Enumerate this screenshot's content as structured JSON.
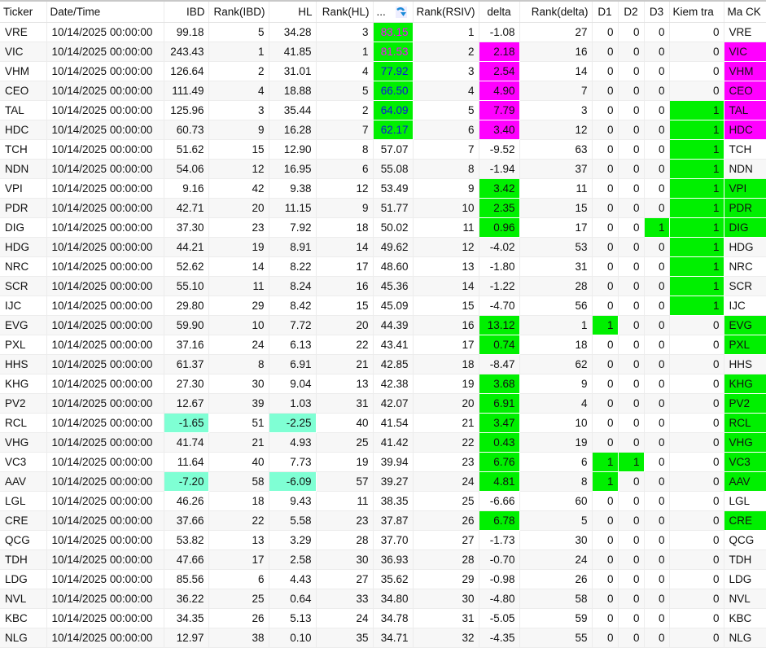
{
  "columns": [
    "Ticker",
    "Date/Time",
    "IBD",
    "Rank(IBD)",
    "HL",
    "Rank(HL)",
    "...",
    "Rank(RSIV)",
    "delta",
    "Rank(delta)",
    "D1",
    "D2",
    "D3",
    "Kiem tra",
    "Ma CK"
  ],
  "sort_icon": "sort-descending-icon",
  "colors": {
    "green": "#00f000",
    "magenta": "#ff00ff",
    "aqua": "#7fffd4",
    "blue_text": "#1010e0",
    "magenta_text": "#ff00ff"
  },
  "rows": [
    {
      "ticker": "VRE",
      "date": "10/14/2025 00:00:00",
      "ibd": "99.18",
      "rank_ibd": "5",
      "hl": "34.28",
      "rank_hl": "3",
      "rsiv": "83.15",
      "rsiv_style": "magenta",
      "rank_rsiv": "1",
      "delta": "-1.08",
      "delta_color": "",
      "rank_delta": "27",
      "d1": "0",
      "d2": "0",
      "d3": "0",
      "kiem_tra": "0",
      "ma_ck": "VRE"
    },
    {
      "ticker": "VIC",
      "date": "10/14/2025 00:00:00",
      "ibd": "243.43",
      "rank_ibd": "1",
      "hl": "41.85",
      "rank_hl": "1",
      "rsiv": "81.53",
      "rsiv_style": "magenta",
      "rank_rsiv": "2",
      "delta": "2.18",
      "delta_color": "magenta",
      "rank_delta": "16",
      "d1": "0",
      "d2": "0",
      "d3": "0",
      "kiem_tra": "0",
      "ma_ck": "VIC"
    },
    {
      "ticker": "VHM",
      "date": "10/14/2025 00:00:00",
      "ibd": "126.64",
      "rank_ibd": "2",
      "hl": "31.01",
      "rank_hl": "4",
      "rsiv": "77.92",
      "rsiv_style": "blue",
      "rank_rsiv": "3",
      "delta": "2.54",
      "delta_color": "magenta",
      "rank_delta": "14",
      "d1": "0",
      "d2": "0",
      "d3": "0",
      "kiem_tra": "0",
      "ma_ck": "VHM"
    },
    {
      "ticker": "CEO",
      "date": "10/14/2025 00:00:00",
      "ibd": "111.49",
      "rank_ibd": "4",
      "hl": "18.88",
      "rank_hl": "5",
      "rsiv": "66.50",
      "rsiv_style": "blue",
      "rank_rsiv": "4",
      "delta": "4.90",
      "delta_color": "magenta",
      "rank_delta": "7",
      "d1": "0",
      "d2": "0",
      "d3": "0",
      "kiem_tra": "0",
      "ma_ck": "CEO"
    },
    {
      "ticker": "TAL",
      "date": "10/14/2025 00:00:00",
      "ibd": "125.96",
      "rank_ibd": "3",
      "hl": "35.44",
      "rank_hl": "2",
      "rsiv": "64.09",
      "rsiv_style": "blue",
      "rank_rsiv": "5",
      "delta": "7.79",
      "delta_color": "magenta",
      "rank_delta": "3",
      "d1": "0",
      "d2": "0",
      "d3": "0",
      "kiem_tra": "1",
      "ma_ck": "TAL"
    },
    {
      "ticker": "HDC",
      "date": "10/14/2025 00:00:00",
      "ibd": "60.73",
      "rank_ibd": "9",
      "hl": "16.28",
      "rank_hl": "7",
      "rsiv": "62.17",
      "rsiv_style": "blue",
      "rank_rsiv": "6",
      "delta": "3.40",
      "delta_color": "magenta",
      "rank_delta": "12",
      "d1": "0",
      "d2": "0",
      "d3": "0",
      "kiem_tra": "1",
      "ma_ck": "HDC"
    },
    {
      "ticker": "TCH",
      "date": "10/14/2025 00:00:00",
      "ibd": "51.62",
      "rank_ibd": "15",
      "hl": "12.90",
      "rank_hl": "8",
      "rsiv": "57.07",
      "rsiv_style": "",
      "rank_rsiv": "7",
      "delta": "-9.52",
      "delta_color": "",
      "rank_delta": "63",
      "d1": "0",
      "d2": "0",
      "d3": "0",
      "kiem_tra": "1",
      "ma_ck": "TCH"
    },
    {
      "ticker": "NDN",
      "date": "10/14/2025 00:00:00",
      "ibd": "54.06",
      "rank_ibd": "12",
      "hl": "16.95",
      "rank_hl": "6",
      "rsiv": "55.08",
      "rsiv_style": "",
      "rank_rsiv": "8",
      "delta": "-1.94",
      "delta_color": "",
      "rank_delta": "37",
      "d1": "0",
      "d2": "0",
      "d3": "0",
      "kiem_tra": "1",
      "ma_ck": "NDN"
    },
    {
      "ticker": "VPI",
      "date": "10/14/2025 00:00:00",
      "ibd": "9.16",
      "rank_ibd": "42",
      "hl": "9.38",
      "rank_hl": "12",
      "rsiv": "53.49",
      "rsiv_style": "",
      "rank_rsiv": "9",
      "delta": "3.42",
      "delta_color": "green",
      "rank_delta": "11",
      "d1": "0",
      "d2": "0",
      "d3": "0",
      "kiem_tra": "1",
      "ma_ck": "VPI"
    },
    {
      "ticker": "PDR",
      "date": "10/14/2025 00:00:00",
      "ibd": "42.71",
      "rank_ibd": "20",
      "hl": "11.15",
      "rank_hl": "9",
      "rsiv": "51.77",
      "rsiv_style": "",
      "rank_rsiv": "10",
      "delta": "2.35",
      "delta_color": "green",
      "rank_delta": "15",
      "d1": "0",
      "d2": "0",
      "d3": "0",
      "kiem_tra": "1",
      "ma_ck": "PDR"
    },
    {
      "ticker": "DIG",
      "date": "10/14/2025 00:00:00",
      "ibd": "37.30",
      "rank_ibd": "23",
      "hl": "7.92",
      "rank_hl": "18",
      "rsiv": "50.02",
      "rsiv_style": "",
      "rank_rsiv": "11",
      "delta": "0.96",
      "delta_color": "green",
      "rank_delta": "17",
      "d1": "0",
      "d2": "0",
      "d3": "1",
      "kiem_tra": "1",
      "ma_ck": "DIG"
    },
    {
      "ticker": "HDG",
      "date": "10/14/2025 00:00:00",
      "ibd": "44.21",
      "rank_ibd": "19",
      "hl": "8.91",
      "rank_hl": "14",
      "rsiv": "49.62",
      "rsiv_style": "",
      "rank_rsiv": "12",
      "delta": "-4.02",
      "delta_color": "",
      "rank_delta": "53",
      "d1": "0",
      "d2": "0",
      "d3": "0",
      "kiem_tra": "1",
      "ma_ck": "HDG"
    },
    {
      "ticker": "NRC",
      "date": "10/14/2025 00:00:00",
      "ibd": "52.62",
      "rank_ibd": "14",
      "hl": "8.22",
      "rank_hl": "17",
      "rsiv": "48.60",
      "rsiv_style": "",
      "rank_rsiv": "13",
      "delta": "-1.80",
      "delta_color": "",
      "rank_delta": "31",
      "d1": "0",
      "d2": "0",
      "d3": "0",
      "kiem_tra": "1",
      "ma_ck": "NRC"
    },
    {
      "ticker": "SCR",
      "date": "10/14/2025 00:00:00",
      "ibd": "55.10",
      "rank_ibd": "11",
      "hl": "8.24",
      "rank_hl": "16",
      "rsiv": "45.36",
      "rsiv_style": "",
      "rank_rsiv": "14",
      "delta": "-1.22",
      "delta_color": "",
      "rank_delta": "28",
      "d1": "0",
      "d2": "0",
      "d3": "0",
      "kiem_tra": "1",
      "ma_ck": "SCR"
    },
    {
      "ticker": "IJC",
      "date": "10/14/2025 00:00:00",
      "ibd": "29.80",
      "rank_ibd": "29",
      "hl": "8.42",
      "rank_hl": "15",
      "rsiv": "45.09",
      "rsiv_style": "",
      "rank_rsiv": "15",
      "delta": "-4.70",
      "delta_color": "",
      "rank_delta": "56",
      "d1": "0",
      "d2": "0",
      "d3": "0",
      "kiem_tra": "1",
      "ma_ck": "IJC"
    },
    {
      "ticker": "EVG",
      "date": "10/14/2025 00:00:00",
      "ibd": "59.90",
      "rank_ibd": "10",
      "hl": "7.72",
      "rank_hl": "20",
      "rsiv": "44.39",
      "rsiv_style": "",
      "rank_rsiv": "16",
      "delta": "13.12",
      "delta_color": "green",
      "rank_delta": "1",
      "d1": "1",
      "d2": "0",
      "d3": "0",
      "kiem_tra": "0",
      "ma_ck": "EVG"
    },
    {
      "ticker": "PXL",
      "date": "10/14/2025 00:00:00",
      "ibd": "37.16",
      "rank_ibd": "24",
      "hl": "6.13",
      "rank_hl": "22",
      "rsiv": "43.41",
      "rsiv_style": "",
      "rank_rsiv": "17",
      "delta": "0.74",
      "delta_color": "green",
      "rank_delta": "18",
      "d1": "0",
      "d2": "0",
      "d3": "0",
      "kiem_tra": "0",
      "ma_ck": "PXL"
    },
    {
      "ticker": "HHS",
      "date": "10/14/2025 00:00:00",
      "ibd": "61.37",
      "rank_ibd": "8",
      "hl": "6.91",
      "rank_hl": "21",
      "rsiv": "42.85",
      "rsiv_style": "",
      "rank_rsiv": "18",
      "delta": "-8.47",
      "delta_color": "",
      "rank_delta": "62",
      "d1": "0",
      "d2": "0",
      "d3": "0",
      "kiem_tra": "0",
      "ma_ck": "HHS"
    },
    {
      "ticker": "KHG",
      "date": "10/14/2025 00:00:00",
      "ibd": "27.30",
      "rank_ibd": "30",
      "hl": "9.04",
      "rank_hl": "13",
      "rsiv": "42.38",
      "rsiv_style": "",
      "rank_rsiv": "19",
      "delta": "3.68",
      "delta_color": "green",
      "rank_delta": "9",
      "d1": "0",
      "d2": "0",
      "d3": "0",
      "kiem_tra": "0",
      "ma_ck": "KHG"
    },
    {
      "ticker": "PV2",
      "date": "10/14/2025 00:00:00",
      "ibd": "12.67",
      "rank_ibd": "39",
      "hl": "1.03",
      "rank_hl": "31",
      "rsiv": "42.07",
      "rsiv_style": "",
      "rank_rsiv": "20",
      "delta": "6.91",
      "delta_color": "green",
      "rank_delta": "4",
      "d1": "0",
      "d2": "0",
      "d3": "0",
      "kiem_tra": "0",
      "ma_ck": "PV2"
    },
    {
      "ticker": "RCL",
      "date": "10/14/2025 00:00:00",
      "ibd": "-1.65",
      "rank_ibd": "51",
      "hl": "-2.25",
      "rank_hl": "40",
      "rsiv": "41.54",
      "rsiv_style": "",
      "rank_rsiv": "21",
      "delta": "3.47",
      "delta_color": "green",
      "rank_delta": "10",
      "d1": "0",
      "d2": "0",
      "d3": "0",
      "kiem_tra": "0",
      "ma_ck": "RCL"
    },
    {
      "ticker": "VHG",
      "date": "10/14/2025 00:00:00",
      "ibd": "41.74",
      "rank_ibd": "21",
      "hl": "4.93",
      "rank_hl": "25",
      "rsiv": "41.42",
      "rsiv_style": "",
      "rank_rsiv": "22",
      "delta": "0.43",
      "delta_color": "green",
      "rank_delta": "19",
      "d1": "0",
      "d2": "0",
      "d3": "0",
      "kiem_tra": "0",
      "ma_ck": "VHG"
    },
    {
      "ticker": "VC3",
      "date": "10/14/2025 00:00:00",
      "ibd": "11.64",
      "rank_ibd": "40",
      "hl": "7.73",
      "rank_hl": "19",
      "rsiv": "39.94",
      "rsiv_style": "",
      "rank_rsiv": "23",
      "delta": "6.76",
      "delta_color": "green",
      "rank_delta": "6",
      "d1": "1",
      "d2": "1",
      "d3": "0",
      "kiem_tra": "0",
      "ma_ck": "VC3"
    },
    {
      "ticker": "AAV",
      "date": "10/14/2025 00:00:00",
      "ibd": "-7.20",
      "rank_ibd": "58",
      "hl": "-6.09",
      "rank_hl": "57",
      "rsiv": "39.27",
      "rsiv_style": "",
      "rank_rsiv": "24",
      "delta": "4.81",
      "delta_color": "green",
      "rank_delta": "8",
      "d1": "1",
      "d2": "0",
      "d3": "0",
      "kiem_tra": "0",
      "ma_ck": "AAV"
    },
    {
      "ticker": "LGL",
      "date": "10/14/2025 00:00:00",
      "ibd": "46.26",
      "rank_ibd": "18",
      "hl": "9.43",
      "rank_hl": "11",
      "rsiv": "38.35",
      "rsiv_style": "",
      "rank_rsiv": "25",
      "delta": "-6.66",
      "delta_color": "",
      "rank_delta": "60",
      "d1": "0",
      "d2": "0",
      "d3": "0",
      "kiem_tra": "0",
      "ma_ck": "LGL"
    },
    {
      "ticker": "CRE",
      "date": "10/14/2025 00:00:00",
      "ibd": "37.66",
      "rank_ibd": "22",
      "hl": "5.58",
      "rank_hl": "23",
      "rsiv": "37.87",
      "rsiv_style": "",
      "rank_rsiv": "26",
      "delta": "6.78",
      "delta_color": "green",
      "rank_delta": "5",
      "d1": "0",
      "d2": "0",
      "d3": "0",
      "kiem_tra": "0",
      "ma_ck": "CRE"
    },
    {
      "ticker": "QCG",
      "date": "10/14/2025 00:00:00",
      "ibd": "53.82",
      "rank_ibd": "13",
      "hl": "3.29",
      "rank_hl": "28",
      "rsiv": "37.70",
      "rsiv_style": "",
      "rank_rsiv": "27",
      "delta": "-1.73",
      "delta_color": "",
      "rank_delta": "30",
      "d1": "0",
      "d2": "0",
      "d3": "0",
      "kiem_tra": "0",
      "ma_ck": "QCG"
    },
    {
      "ticker": "TDH",
      "date": "10/14/2025 00:00:00",
      "ibd": "47.66",
      "rank_ibd": "17",
      "hl": "2.58",
      "rank_hl": "30",
      "rsiv": "36.93",
      "rsiv_style": "",
      "rank_rsiv": "28",
      "delta": "-0.70",
      "delta_color": "",
      "rank_delta": "24",
      "d1": "0",
      "d2": "0",
      "d3": "0",
      "kiem_tra": "0",
      "ma_ck": "TDH"
    },
    {
      "ticker": "LDG",
      "date": "10/14/2025 00:00:00",
      "ibd": "85.56",
      "rank_ibd": "6",
      "hl": "4.43",
      "rank_hl": "27",
      "rsiv": "35.62",
      "rsiv_style": "",
      "rank_rsiv": "29",
      "delta": "-0.98",
      "delta_color": "",
      "rank_delta": "26",
      "d1": "0",
      "d2": "0",
      "d3": "0",
      "kiem_tra": "0",
      "ma_ck": "LDG"
    },
    {
      "ticker": "NVL",
      "date": "10/14/2025 00:00:00",
      "ibd": "36.22",
      "rank_ibd": "25",
      "hl": "0.64",
      "rank_hl": "33",
      "rsiv": "34.80",
      "rsiv_style": "",
      "rank_rsiv": "30",
      "delta": "-4.80",
      "delta_color": "",
      "rank_delta": "58",
      "d1": "0",
      "d2": "0",
      "d3": "0",
      "kiem_tra": "0",
      "ma_ck": "NVL"
    },
    {
      "ticker": "KBC",
      "date": "10/14/2025 00:00:00",
      "ibd": "34.35",
      "rank_ibd": "26",
      "hl": "5.13",
      "rank_hl": "24",
      "rsiv": "34.78",
      "rsiv_style": "",
      "rank_rsiv": "31",
      "delta": "-5.05",
      "delta_color": "",
      "rank_delta": "59",
      "d1": "0",
      "d2": "0",
      "d3": "0",
      "kiem_tra": "0",
      "ma_ck": "KBC"
    },
    {
      "ticker": "NLG",
      "date": "10/14/2025 00:00:00",
      "ibd": "12.97",
      "rank_ibd": "38",
      "hl": "0.10",
      "rank_hl": "35",
      "rsiv": "34.71",
      "rsiv_style": "",
      "rank_rsiv": "32",
      "delta": "-4.35",
      "delta_color": "",
      "rank_delta": "55",
      "d1": "0",
      "d2": "0",
      "d3": "0",
      "kiem_tra": "0",
      "ma_ck": "NLG"
    }
  ]
}
